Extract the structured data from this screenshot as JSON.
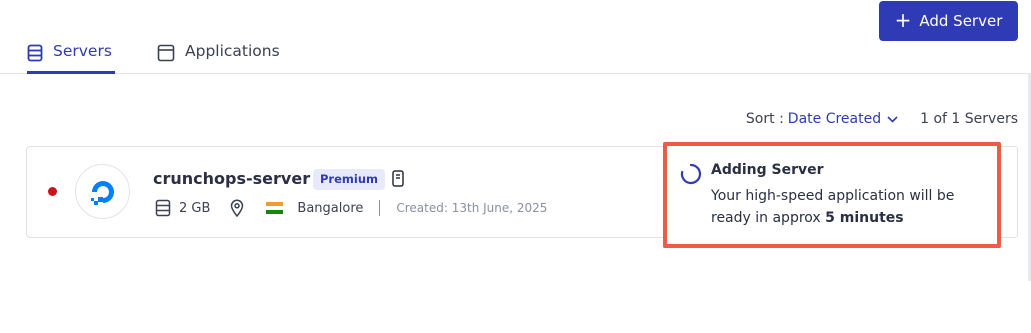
{
  "header": {
    "add_server_label": "Add Server"
  },
  "tabs": [
    {
      "label": "Servers",
      "icon": "server-stack-icon",
      "active": true
    },
    {
      "label": "Applications",
      "icon": "window-icon",
      "active": false
    }
  ],
  "sort": {
    "label": "Sort :",
    "value": "Date Created",
    "count": "1 of 1 Servers"
  },
  "servers": [
    {
      "name": "crunchops-server",
      "badge": "Premium",
      "status_color": "#d0101b",
      "provider_icon": "digitalocean-logo-icon",
      "ram": "2 GB",
      "location": "Bangalore",
      "flag": "india-flag-icon",
      "created": "Created: 13th June, 2025"
    }
  ],
  "adding_panel": {
    "title": "Adding Server",
    "message_prefix": "Your high-speed application will be ready in approx ",
    "message_emphasis": "5 minutes"
  },
  "colors": {
    "accent": "#2f3bb5",
    "highlight_border": "#ee5b47",
    "badge_bg": "#e8e9fb"
  }
}
